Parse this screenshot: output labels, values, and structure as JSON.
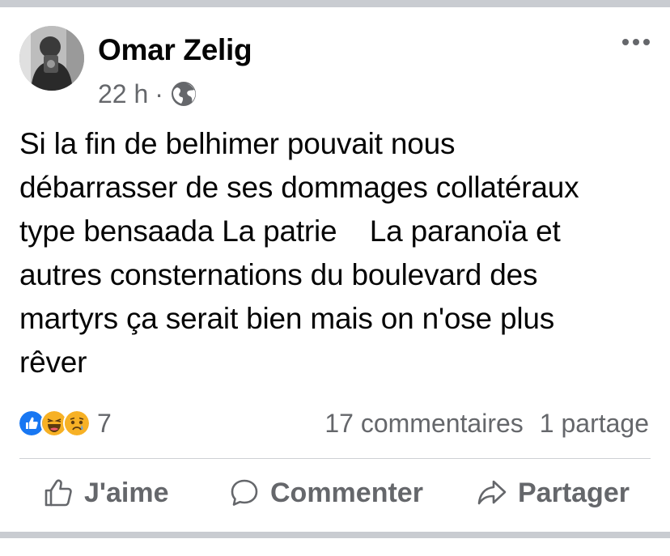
{
  "post": {
    "author": "Omar Zelig",
    "time": "22 h",
    "time_separator": "·",
    "audience_icon": "globe-icon",
    "text_lines": [
      "Si la fin de belhimer pouvait nous",
      "débarrasser de ses dommages collatéraux",
      "type bensaada La patrie    La paranoïa et",
      "autres consternations du boulevard des",
      "martyrs ça serait bien mais on n'ose plus",
      "rêver"
    ]
  },
  "engagement": {
    "reaction_icons": [
      "like-reaction-icon",
      "haha-reaction-icon",
      "sad-reaction-icon"
    ],
    "reaction_count": "7",
    "comments": "17 commentaires",
    "shares": "1 partage"
  },
  "actions": {
    "like": "J'aime",
    "comment": "Commenter",
    "share": "Partager"
  },
  "colors": {
    "separator": "#c9ccd1",
    "secondary_text": "#65676b",
    "like_blue": "#1877f2",
    "haha_yellow": "#f7b125"
  }
}
